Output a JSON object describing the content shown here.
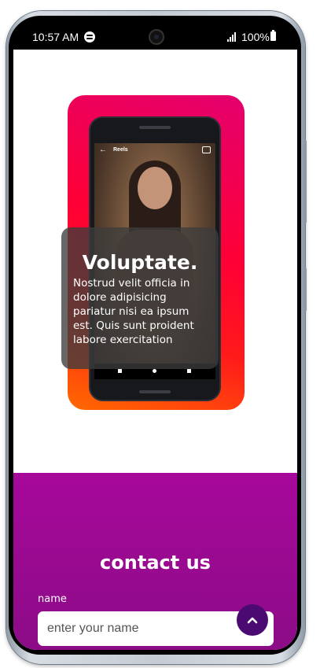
{
  "status_bar": {
    "time": "10:57 AM",
    "battery": "100%"
  },
  "hero": {
    "reels_label": "Reels",
    "overlay_title": "Voluptate.",
    "overlay_text": "Nostrud velit officia in dolore adipisicing pariatur nisi ea ipsum est. Quis sunt proident labore exercitation"
  },
  "contact": {
    "title": "contact us",
    "name_label": "name",
    "name_placeholder": "enter your name"
  },
  "icons": {
    "app_status": "spotify-icon",
    "signal": "signal-icon",
    "battery": "battery-icon",
    "scroll_top": "chevron-up-icon"
  },
  "colors": {
    "contact_bg": "#9a0a90",
    "scroll_top_bg": "#4b0a72"
  }
}
